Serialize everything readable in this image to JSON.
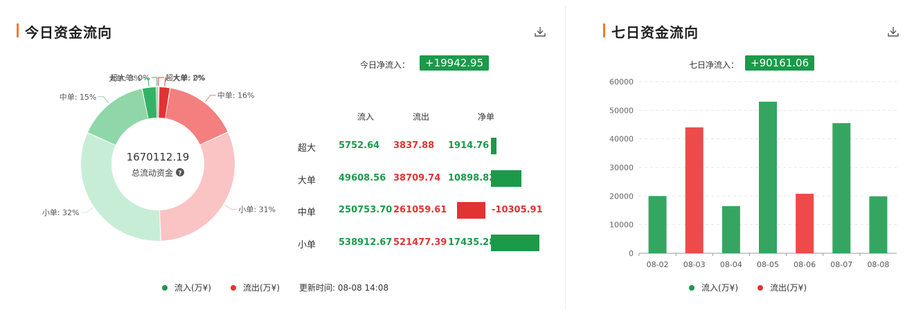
{
  "colors": {
    "inflow": "#1b9a4a",
    "outflow": "#e23333",
    "accent": "#f47a20"
  },
  "today": {
    "title": "今日资金流向",
    "net_label": "今日净流入：",
    "net_value": "+19942.95",
    "center_value": "1670112.19",
    "center_label": "总流动资金",
    "table": {
      "headers": {
        "inflow": "流入",
        "outflow": "流出",
        "net": "净单"
      },
      "rows": [
        {
          "label": "超大",
          "inflow": "5752.64",
          "outflow": "3837.88",
          "net": "1914.76"
        },
        {
          "label": "大单",
          "inflow": "49608.56",
          "outflow": "38709.74",
          "net": "10898.82"
        },
        {
          "label": "中单",
          "inflow": "250753.70",
          "outflow": "261059.61",
          "net": "-10305.91"
        },
        {
          "label": "小单",
          "inflow": "538912.67",
          "outflow": "521477.39",
          "net": "17435.28"
        }
      ]
    },
    "legend": {
      "inflow": "流入(万¥)",
      "outflow": "流出(万¥)",
      "update": "更新时间: 08-08 14:08"
    }
  },
  "week": {
    "title": "七日资金流向",
    "net_label": "七日净流入：",
    "net_value": "+90161.06",
    "legend": {
      "inflow": "流入(万¥)",
      "outflow": "流出(万¥)"
    }
  },
  "chart_data": [
    {
      "type": "pie",
      "variant": "donut",
      "slices": [
        {
          "label": "超大单: 0%",
          "value": 5752.64,
          "flow": "inflow",
          "color": "#35b267"
        },
        {
          "label": "大单: 3%",
          "value": 49608.56,
          "flow": "inflow",
          "color": "#35b267"
        },
        {
          "label": "中单: 15%",
          "value": 250753.7,
          "flow": "inflow",
          "color": "#8fd7a8"
        },
        {
          "label": "小单: 32%",
          "value": 538912.67,
          "flow": "inflow",
          "color": "#c8edd6"
        },
        {
          "label": "超大单: 0%",
          "value": 3837.88,
          "flow": "outflow",
          "color": "#e23333"
        },
        {
          "label": "大单: 2%",
          "value": 38709.74,
          "flow": "outflow",
          "color": "#e23333"
        },
        {
          "label": "中单: 16%",
          "value": 261059.61,
          "flow": "outflow",
          "color": "#f47f7f"
        },
        {
          "label": "小单: 31%",
          "value": 521477.39,
          "flow": "outflow",
          "color": "#fbc4c4"
        }
      ]
    },
    {
      "type": "bar",
      "categories": [
        "08-02",
        "08-03",
        "08-04",
        "08-05",
        "08-06",
        "08-07",
        "08-08"
      ],
      "values": [
        20000,
        44000,
        16500,
        53000,
        20800,
        45500,
        19900
      ],
      "flows": [
        "inflow",
        "outflow",
        "inflow",
        "inflow",
        "outflow",
        "inflow",
        "inflow"
      ],
      "ylim": [
        0,
        60000
      ],
      "yticks": [
        0,
        10000,
        20000,
        30000,
        40000,
        50000,
        60000
      ],
      "grid": true
    }
  ]
}
